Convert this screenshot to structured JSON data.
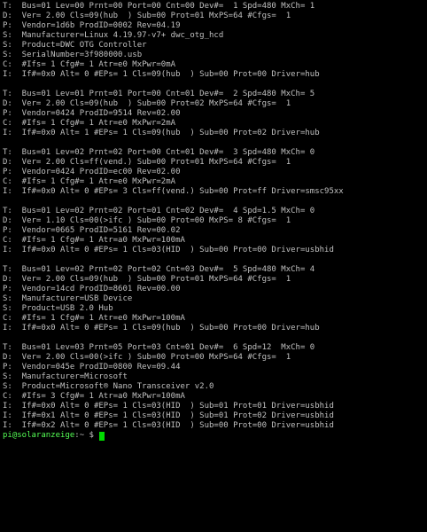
{
  "terminal": {
    "lines": [
      "T:  Bus=01 Lev=00 Prnt=00 Port=00 Cnt=00 Dev#=  1 Spd=480 MxCh= 1",
      "D:  Ver= 2.00 Cls=09(hub  ) Sub=00 Prot=01 MxPS=64 #Cfgs=  1",
      "P:  Vendor=1d6b ProdID=0002 Rev=04.19",
      "S:  Manufacturer=Linux 4.19.97-v7+ dwc_otg_hcd",
      "S:  Product=DWC OTG Controller",
      "S:  SerialNumber=3f980000.usb",
      "C:  #Ifs= 1 Cfg#= 1 Atr=e0 MxPwr=0mA",
      "I:  If#=0x0 Alt= 0 #EPs= 1 Cls=09(hub  ) Sub=00 Prot=00 Driver=hub",
      "",
      "T:  Bus=01 Lev=01 Prnt=01 Port=00 Cnt=01 Dev#=  2 Spd=480 MxCh= 5",
      "D:  Ver= 2.00 Cls=09(hub  ) Sub=00 Prot=02 MxPS=64 #Cfgs=  1",
      "P:  Vendor=0424 ProdID=9514 Rev=02.00",
      "C:  #Ifs= 1 Cfg#= 1 Atr=e0 MxPwr=2mA",
      "I:  If#=0x0 Alt= 1 #EPs= 1 Cls=09(hub  ) Sub=00 Prot=02 Driver=hub",
      "",
      "T:  Bus=01 Lev=02 Prnt=02 Port=00 Cnt=01 Dev#=  3 Spd=480 MxCh= 0",
      "D:  Ver= 2.00 Cls=ff(vend.) Sub=00 Prot=01 MxPS=64 #Cfgs=  1",
      "P:  Vendor=0424 ProdID=ec00 Rev=02.00",
      "C:  #Ifs= 1 Cfg#= 1 Atr=e0 MxPwr=2mA",
      "I:  If#=0x0 Alt= 0 #EPs= 3 Cls=ff(vend.) Sub=00 Prot=ff Driver=smsc95xx",
      "",
      "T:  Bus=01 Lev=02 Prnt=02 Port=01 Cnt=02 Dev#=  4 Spd=1.5 MxCh= 0",
      "D:  Ver= 1.10 Cls=00(>ifc ) Sub=00 Prot=00 MxPS= 8 #Cfgs=  1",
      "P:  Vendor=0665 ProdID=5161 Rev=00.02",
      "C:  #Ifs= 1 Cfg#= 1 Atr=a0 MxPwr=100mA",
      "I:  If#=0x0 Alt= 0 #EPs= 1 Cls=03(HID  ) Sub=00 Prot=00 Driver=usbhid",
      "",
      "T:  Bus=01 Lev=02 Prnt=02 Port=02 Cnt=03 Dev#=  5 Spd=480 MxCh= 4",
      "D:  Ver= 2.00 Cls=09(hub  ) Sub=00 Prot=01 MxPS=64 #Cfgs=  1",
      "P:  Vendor=14cd ProdID=8601 Rev=00.00",
      "S:  Manufacturer=USB Device",
      "S:  Product=USB 2.0 Hub",
      "C:  #Ifs= 1 Cfg#= 1 Atr=e0 MxPwr=100mA",
      "I:  If#=0x0 Alt= 0 #EPs= 1 Cls=09(hub  ) Sub=00 Prot=00 Driver=hub",
      "",
      "T:  Bus=01 Lev=03 Prnt=05 Port=03 Cnt=01 Dev#=  6 Spd=12  MxCh= 0",
      "D:  Ver= 2.00 Cls=00(>ifc ) Sub=00 Prot=00 MxPS=64 #Cfgs=  1",
      "P:  Vendor=045e ProdID=0800 Rev=09.44",
      "S:  Manufacturer=Microsoft",
      "S:  Product=Microsoft® Nano Transceiver v2.0",
      "C:  #Ifs= 3 Cfg#= 1 Atr=a0 MxPwr=100mA",
      "I:  If#=0x0 Alt= 0 #EPs= 1 Cls=03(HID  ) Sub=01 Prot=01 Driver=usbhid",
      "I:  If#=0x1 Alt= 0 #EPs= 1 Cls=03(HID  ) Sub=01 Prot=02 Driver=usbhid",
      "I:  If#=0x2 Alt= 0 #EPs= 1 Cls=03(HID  ) Sub=00 Prot=00 Driver=usbhid"
    ],
    "prompt": {
      "user_host": "pi@solaranzeige",
      "rest": ":~ $ "
    },
    "colors": {
      "background": "#000000",
      "text": "#c0c0c0",
      "prompt_user": "#55ff55",
      "cursor": "#00dd00"
    }
  }
}
